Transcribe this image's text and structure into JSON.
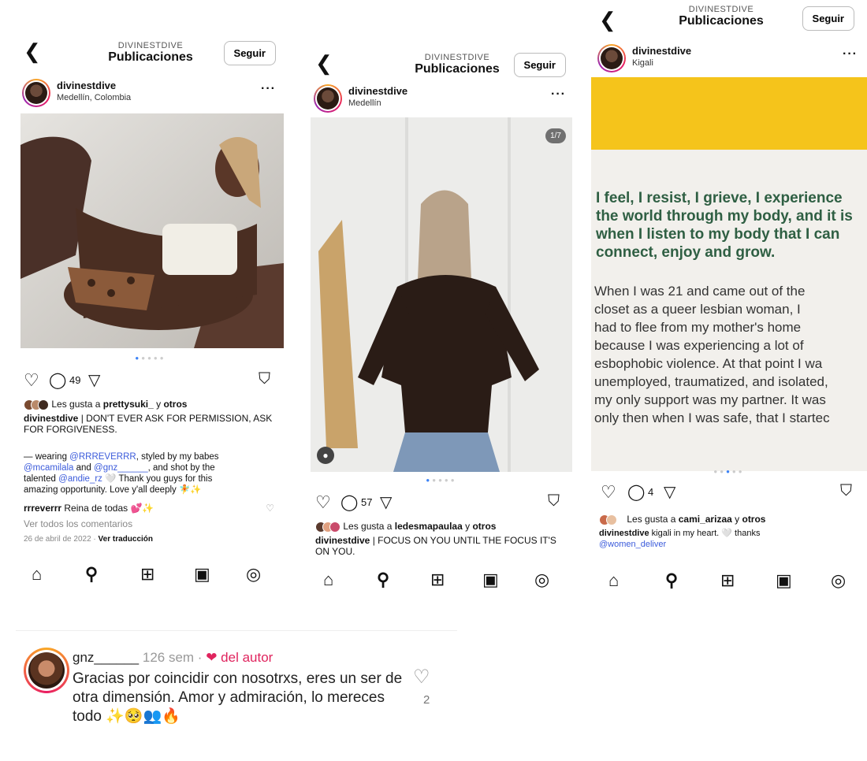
{
  "phones": [
    {
      "topbar": {
        "username": "DIVINESTDIVE",
        "section": "Publicaciones",
        "follow": "Seguir"
      },
      "post": {
        "user": "divinestdive",
        "location": "Medellín, Colombia"
      },
      "comment_count": "49",
      "likes": {
        "prefix": "Les gusta a",
        "user": "prettysuki_",
        "and": "y",
        "others": "otros"
      },
      "caption": {
        "user": "divinestdive",
        "text": "| DON'T EVER ASK FOR PERMISSION, ASK FOR FORGIVENESS.",
        "l1a": "— wearing",
        "m1": "@RRREVERRR",
        "l1b": ", styled by my babes",
        "m2": "@mcamilala",
        "l2a": "and",
        "m3": "@gnz______",
        "l2b": ", and shot by the",
        "l3a": "talented",
        "m4": "@andie_rz",
        "l3b": "🤍 Thank you guys for this",
        "l4": "amazing opportunity. Love y'all deeply 🧚✨"
      },
      "reply": {
        "user": "rrreverrr",
        "text": "Reina de todas 💕✨"
      },
      "see_all": "Ver todos los comentarios",
      "date": "26 de abril de 2022",
      "translate": "Ver traducción"
    },
    {
      "topbar": {
        "username": "DIVINESTDIVE",
        "section": "Publicaciones",
        "follow": "Seguir"
      },
      "post": {
        "user": "divinestdive",
        "location": "Medellín"
      },
      "counter": "1/7",
      "comment_count": "57",
      "likes": {
        "prefix": "Les gusta a",
        "user": "ledesmapaulaa",
        "and": "y",
        "others": "otros"
      },
      "caption": {
        "user": "divinestdive",
        "text": "| FOCUS ON YOU UNTIL THE FOCUS IT'S ON YOU."
      }
    },
    {
      "topbar": {
        "username": "DIVINESTDIVE",
        "section": "Publicaciones",
        "follow": "Seguir"
      },
      "post": {
        "user": "divinestdive",
        "location": "Kigali"
      },
      "comment_count": "4",
      "poster": {
        "q1": "I feel, I resist, I grieve, I experience",
        "q2": "the world through my body, and it is",
        "q3": "when I listen to my body that I can",
        "q4": "connect, enjoy and grow.",
        "b1": "When I was 21 and came out of the",
        "b2": "closet as a queer lesbian woman, I",
        "b3": "had to flee from my mother's home",
        "b4": "because I was experiencing a lot of",
        "b5": "esbophobic violence. At that point I wa",
        "b6": "unemployed, traumatized, and isolated,",
        "b7": "my only support was my partner. It was",
        "b8": "only then when I was safe, that I startec"
      },
      "likes": {
        "prefix": "Les gusta a",
        "user": "cami_arizaa",
        "and": "y",
        "others": "otros"
      },
      "caption": {
        "user": "divinestdive",
        "text": "kigali in my heart. 🤍 thanks",
        "mention": "@women_deliver"
      }
    }
  ],
  "comment": {
    "user": "gnz______",
    "meta": "126 sem ·",
    "liked": "❤ del autor",
    "text": "Gracias por coincidir con nosotrxs, eres un ser de otra dimensión. Amor y admiración, lo mereces todo ✨🥺👥🔥",
    "likes": "2"
  },
  "icons": [
    "back-icon",
    "more-icon",
    "heart-icon",
    "comment-icon",
    "share-icon",
    "bookmark-icon",
    "home-icon",
    "search-icon",
    "new-post-icon",
    "reels-icon",
    "profile-icon"
  ],
  "colors": {
    "accent": "#3b82f6",
    "link": "#3b5bdb",
    "poster_yellow": "#f5c41b",
    "poster_green": "#2f5f43"
  }
}
